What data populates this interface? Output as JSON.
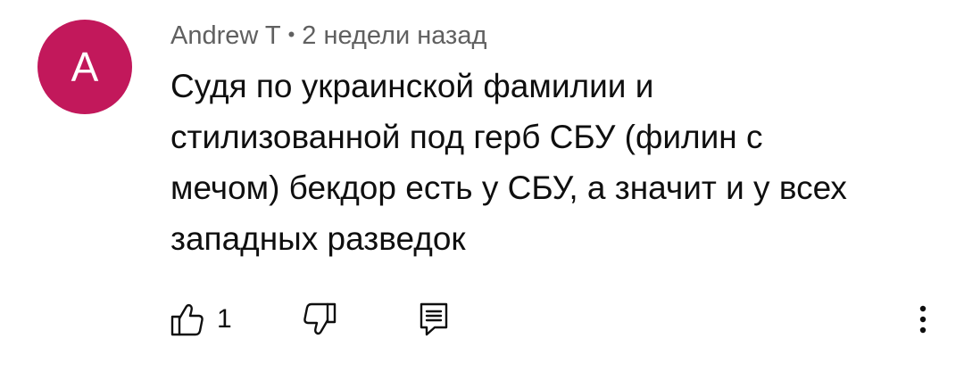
{
  "comment": {
    "avatar_letter": "A",
    "avatar_color": "#c2185b",
    "author": "Andrew T",
    "separator": "•",
    "time": "2 недели назад",
    "text_lines": [
      "Судя по украинской фамилии и",
      "стилизованной под герб СБУ (филин с",
      "мечом) бекдор есть у СБУ, а значит и у всех",
      "западных разведок"
    ],
    "like_count": "1"
  },
  "icons": {
    "like": "thumbs-up-icon",
    "dislike": "thumbs-down-icon",
    "reply": "reply-icon",
    "more": "more-vertical-icon"
  },
  "colors": {
    "text": "#0f0f0f",
    "meta": "#606060",
    "icon": "#0f0f0f"
  }
}
